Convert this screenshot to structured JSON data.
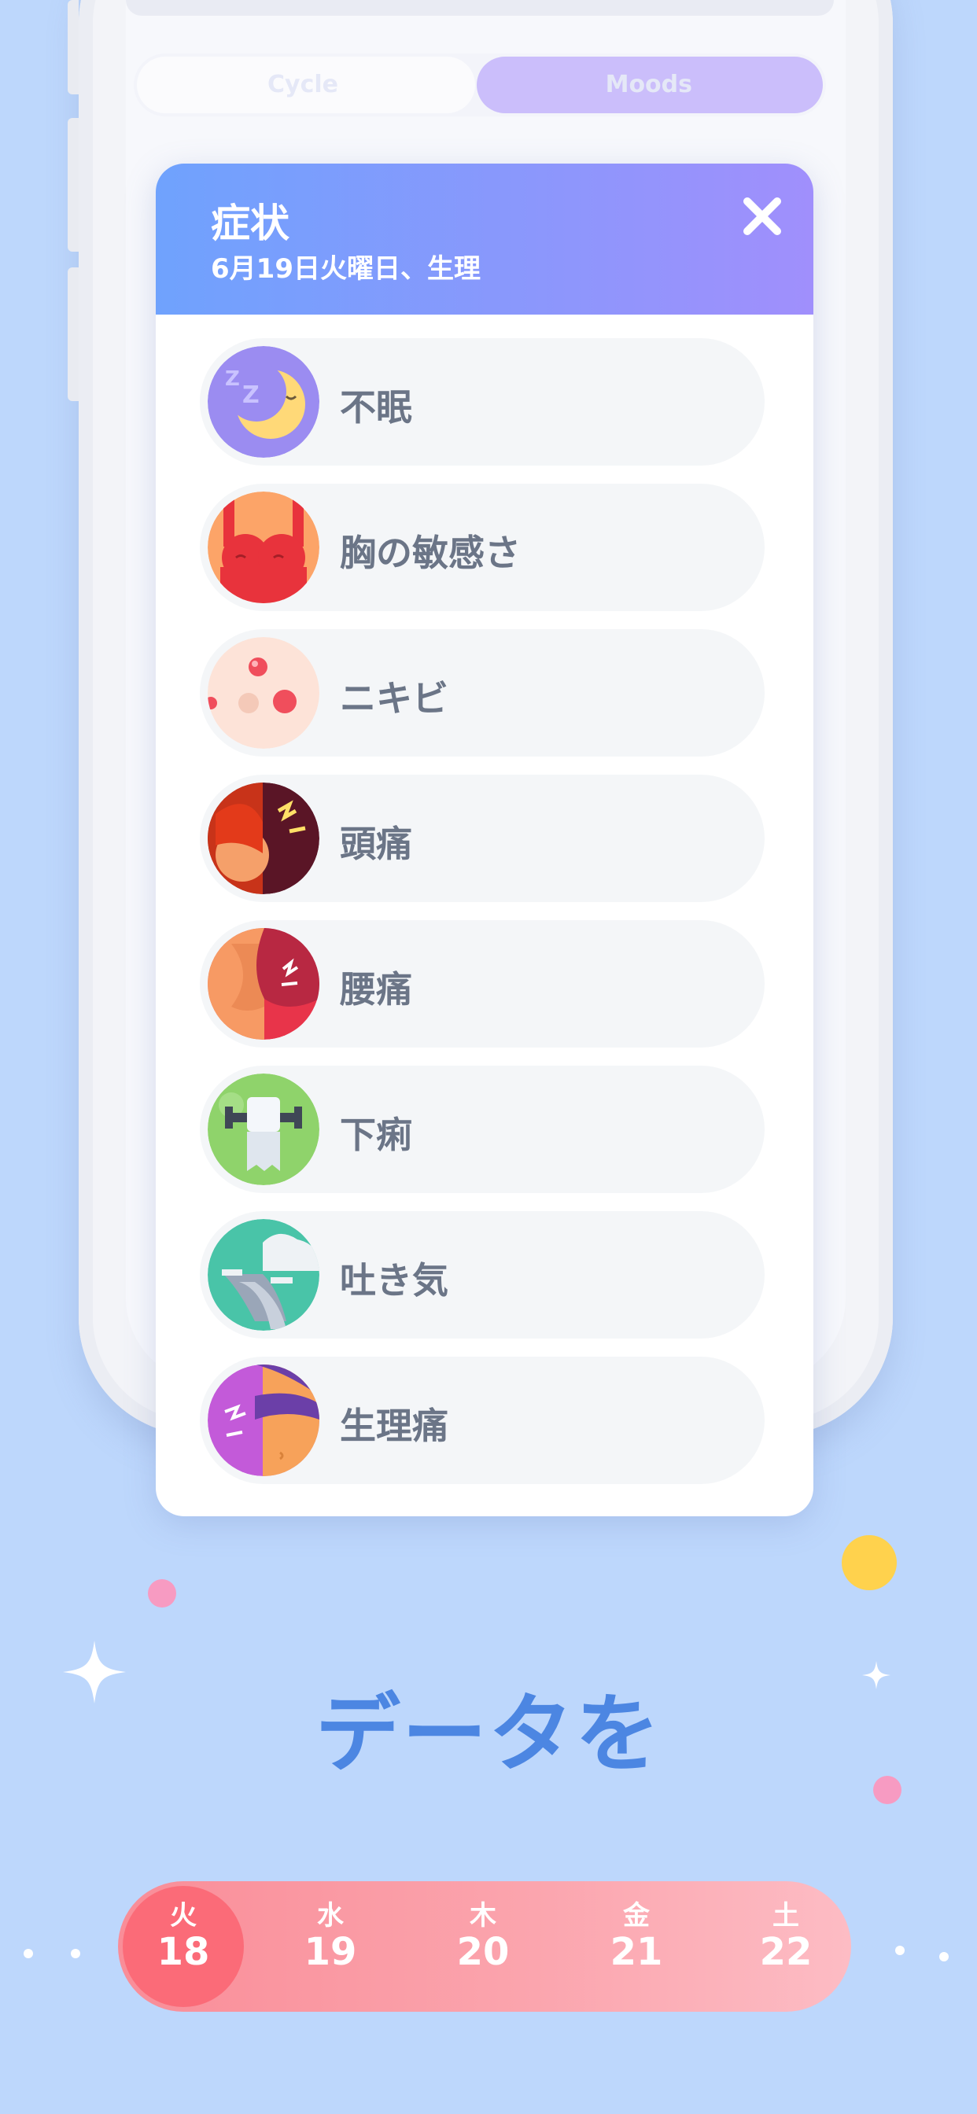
{
  "background_segment": {
    "left_label": "Cycle",
    "right_label": "Moods"
  },
  "modal": {
    "title": "症状",
    "subtitle": "6月19日火曜日、生理",
    "symptoms": [
      {
        "label": "不眠",
        "icon": "sleeping-moon-icon"
      },
      {
        "label": "胸の敏感さ",
        "icon": "breast-tenderness-icon"
      },
      {
        "label": "ニキビ",
        "icon": "acne-icon"
      },
      {
        "label": "頭痛",
        "icon": "headache-icon"
      },
      {
        "label": "腰痛",
        "icon": "back-pain-icon"
      },
      {
        "label": "下痢",
        "icon": "toilet-paper-icon"
      },
      {
        "label": "吐き気",
        "icon": "nausea-icon"
      },
      {
        "label": "生理痛",
        "icon": "period-cramps-icon"
      }
    ]
  },
  "headline": "データを",
  "calendar": [
    {
      "weekday": "火",
      "day": "18",
      "selected": true
    },
    {
      "weekday": "水",
      "day": "19",
      "selected": false
    },
    {
      "weekday": "木",
      "day": "20",
      "selected": false
    },
    {
      "weekday": "金",
      "day": "21",
      "selected": false
    },
    {
      "weekday": "土",
      "day": "22",
      "selected": false
    }
  ],
  "colors": {
    "background": "#bdd7fc",
    "header_gradient_start": "#6fa2fd",
    "header_gradient_end": "#a08ffc",
    "headline": "#4c86e2",
    "selected_day": "#fb6b78"
  }
}
